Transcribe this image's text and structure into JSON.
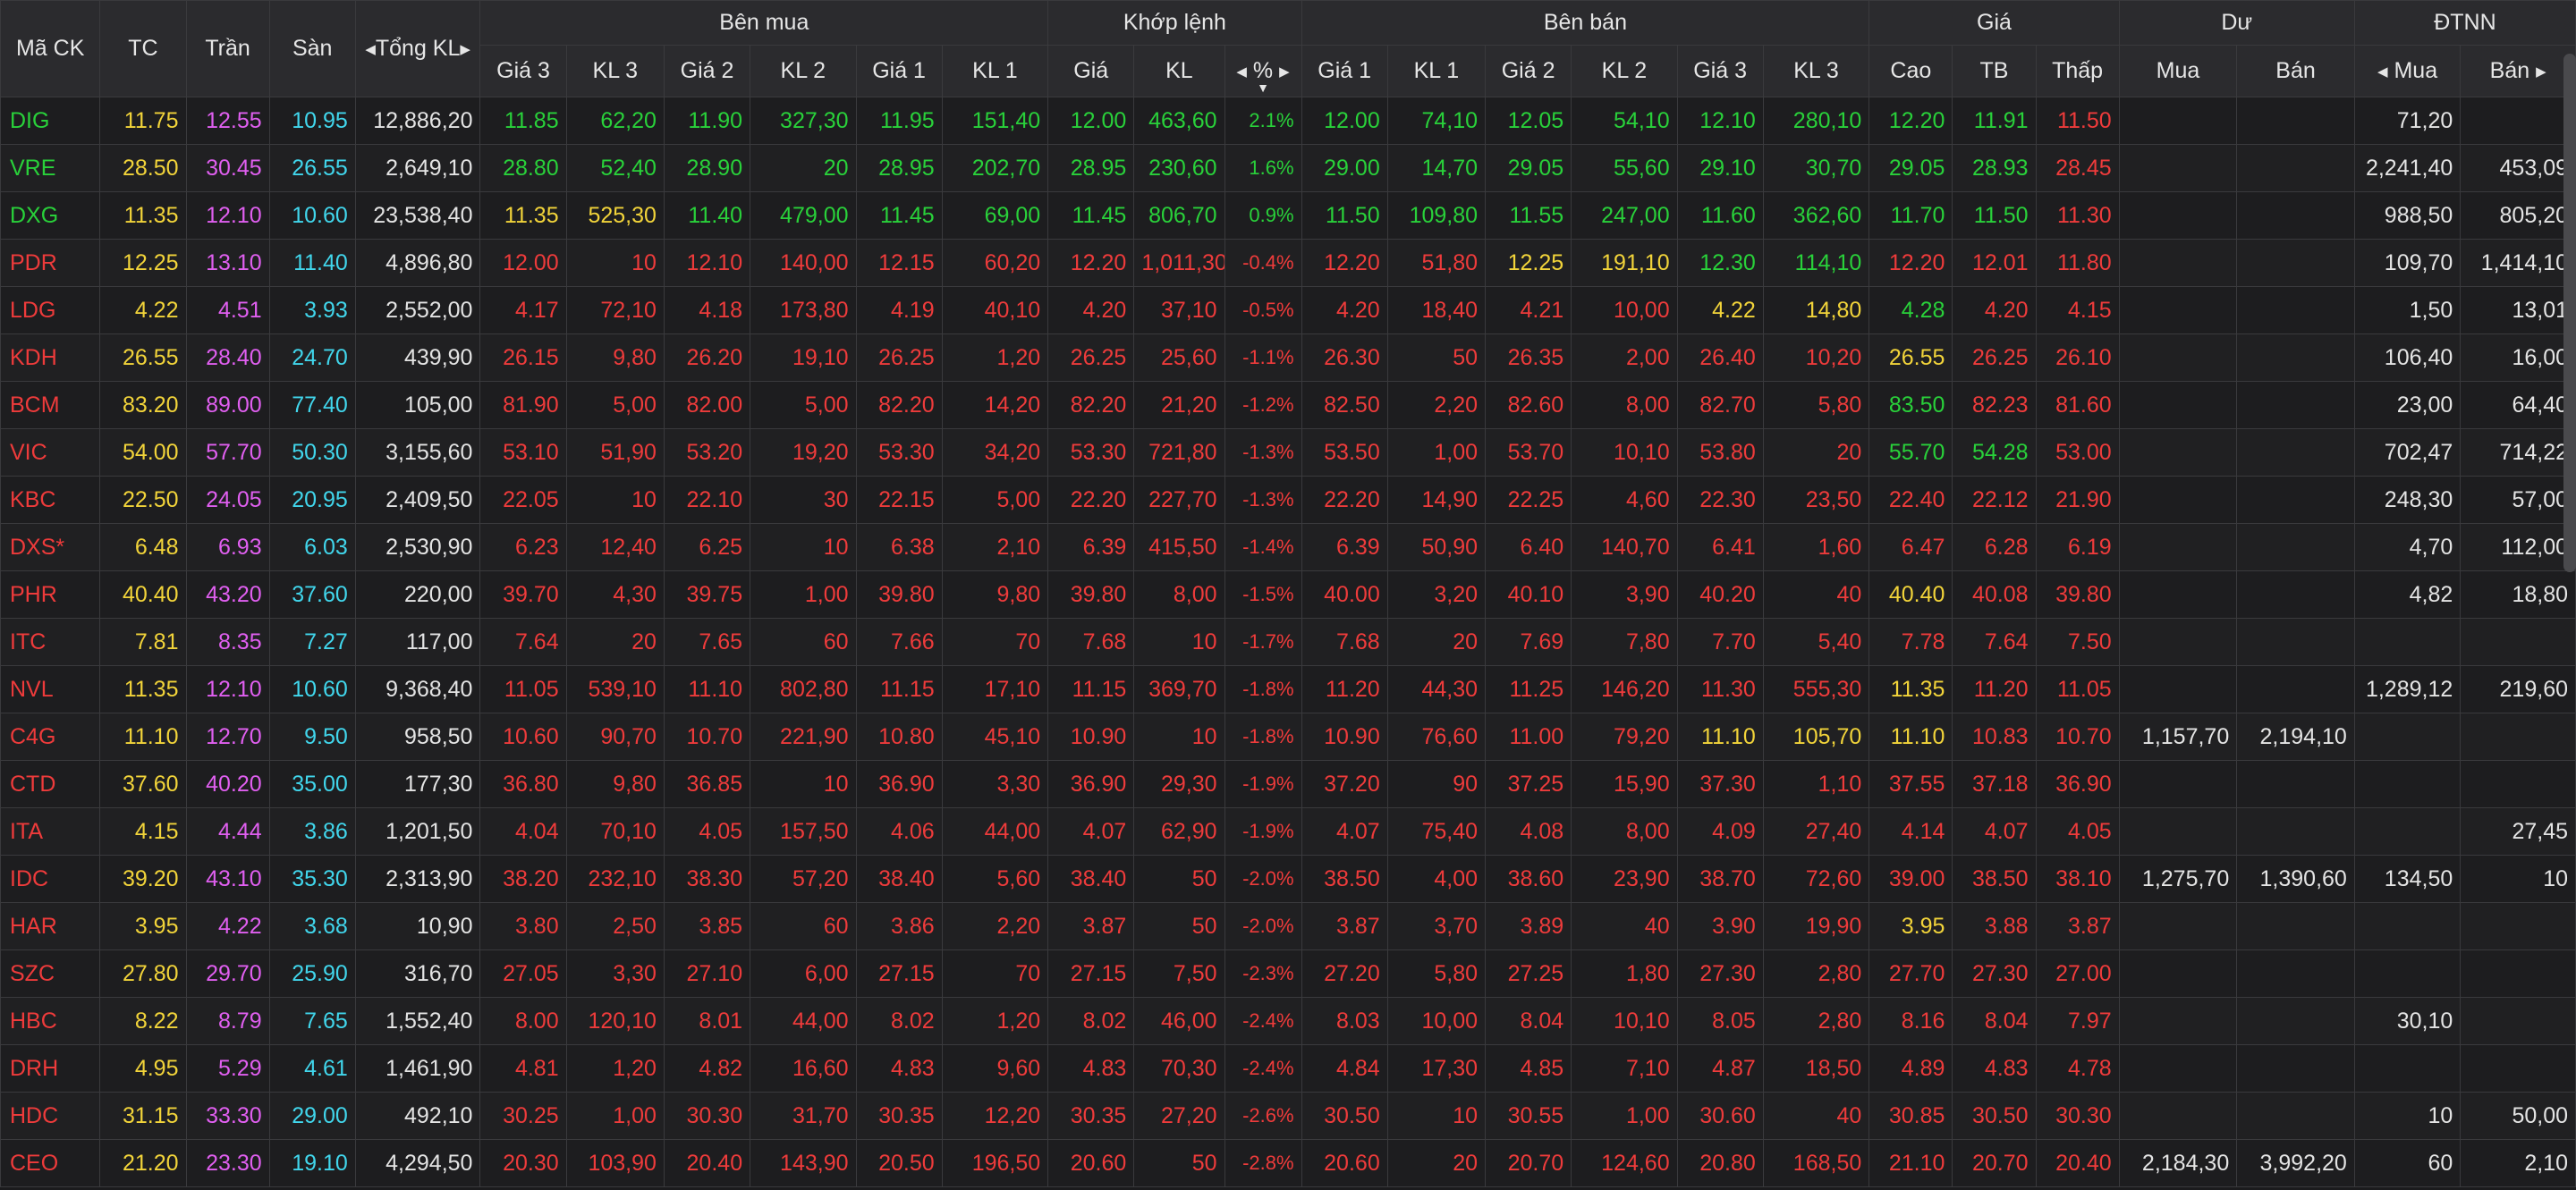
{
  "header": {
    "symbol": "Mã CK",
    "ref": "TC",
    "ceiling": "Trần",
    "floor": "Sàn",
    "total_volume": "Tổng KL",
    "buy_group": "Bên mua",
    "match_group": "Khớp lệnh",
    "sell_group": "Bên bán",
    "price_group": "Giá",
    "surplus_group": "Dư",
    "foreign_group": "ĐTNN",
    "bid3_price": "Giá 3",
    "bid3_vol": "KL 3",
    "bid2_price": "Giá 2",
    "bid2_vol": "KL 2",
    "bid1_price": "Giá 1",
    "bid1_vol": "KL 1",
    "match_price": "Giá",
    "match_vol": "KL",
    "match_pct": "%",
    "ask1_price": "Giá 1",
    "ask1_vol": "KL 1",
    "ask2_price": "Giá 2",
    "ask2_vol": "KL 2",
    "ask3_price": "Giá 3",
    "ask3_vol": "KL 3",
    "high": "Cao",
    "avg": "TB",
    "low": "Thấp",
    "surplus_buy": "Mua",
    "surplus_sell": "Bán",
    "foreign_buy": "Mua",
    "foreign_sell": "Bán"
  },
  "icons": {
    "left_arrow": "caret-left-icon",
    "right_arrow": "caret-right-icon",
    "sort_down": "sort-down-icon"
  },
  "colors": {
    "up": "#29d13a",
    "down": "#ee3b3b",
    "reference": "#f2d43a",
    "ceiling": "#e05ff0",
    "floor": "#41d6ec",
    "background": "#1b1b1d",
    "header_bg": "#2b2b2e"
  },
  "rows": [
    {
      "sym": "DIG",
      "tc": "11.75",
      "tran": "12.55",
      "san": "10.95",
      "tong": "12,886,20",
      "g3": "11.85",
      "k3": "62,20",
      "g2": "11.90",
      "k2": "327,30",
      "g1": "11.95",
      "k1": "151,40",
      "mp": "12.00",
      "mv": "463,60",
      "pct": "2.1%",
      "ag1": "12.00",
      "av1": "74,10",
      "ag2": "12.05",
      "av2": "54,10",
      "ag3": "12.10",
      "av3": "280,10",
      "cao": "12.20",
      "tb": "11.91",
      "thap": "11.50",
      "dm": "",
      "db": "",
      "fm": "71,20",
      "fb": ""
    },
    {
      "sym": "VRE",
      "tc": "28.50",
      "tran": "30.45",
      "san": "26.55",
      "tong": "2,649,10",
      "g3": "28.80",
      "k3": "52,40",
      "g2": "28.90",
      "k2": "20",
      "g1": "28.95",
      "k1": "202,70",
      "mp": "28.95",
      "mv": "230,60",
      "pct": "1.6%",
      "ag1": "29.00",
      "av1": "14,70",
      "ag2": "29.05",
      "av2": "55,60",
      "ag3": "29.10",
      "av3": "30,70",
      "cao": "29.05",
      "tb": "28.93",
      "thap": "28.45",
      "dm": "",
      "db": "",
      "fm": "2,241,40",
      "fb": "453,09"
    },
    {
      "sym": "DXG",
      "tc": "11.35",
      "tran": "12.10",
      "san": "10.60",
      "tong": "23,538,40",
      "g3": "11.35",
      "k3": "525,30",
      "g2": "11.40",
      "k2": "479,00",
      "g1": "11.45",
      "k1": "69,00",
      "mp": "11.45",
      "mv": "806,70",
      "pct": "0.9%",
      "ag1": "11.50",
      "av1": "109,80",
      "ag2": "11.55",
      "av2": "247,00",
      "ag3": "11.60",
      "av3": "362,60",
      "cao": "11.70",
      "tb": "11.50",
      "thap": "11.30",
      "dm": "",
      "db": "",
      "fm": "988,50",
      "fb": "805,20"
    },
    {
      "sym": "PDR",
      "tc": "12.25",
      "tran": "13.10",
      "san": "11.40",
      "tong": "4,896,80",
      "g3": "12.00",
      "k3": "10",
      "g2": "12.10",
      "k2": "140,00",
      "g1": "12.15",
      "k1": "60,20",
      "mp": "12.20",
      "mv": "1,011,30",
      "pct": "-0.4%",
      "ag1": "12.20",
      "av1": "51,80",
      "ag2": "12.25",
      "av2": "191,10",
      "ag3": "12.30",
      "av3": "114,10",
      "cao": "12.20",
      "tb": "12.01",
      "thap": "11.80",
      "dm": "",
      "db": "",
      "fm": "109,70",
      "fb": "1,414,10"
    },
    {
      "sym": "LDG",
      "tc": "4.22",
      "tran": "4.51",
      "san": "3.93",
      "tong": "2,552,00",
      "g3": "4.17",
      "k3": "72,10",
      "g2": "4.18",
      "k2": "173,80",
      "g1": "4.19",
      "k1": "40,10",
      "mp": "4.20",
      "mv": "37,10",
      "pct": "-0.5%",
      "ag1": "4.20",
      "av1": "18,40",
      "ag2": "4.21",
      "av2": "10,00",
      "ag3": "4.22",
      "av3": "14,80",
      "cao": "4.28",
      "tb": "4.20",
      "thap": "4.15",
      "dm": "",
      "db": "",
      "fm": "1,50",
      "fb": "13,01"
    },
    {
      "sym": "KDH",
      "tc": "26.55",
      "tran": "28.40",
      "san": "24.70",
      "tong": "439,90",
      "g3": "26.15",
      "k3": "9,80",
      "g2": "26.20",
      "k2": "19,10",
      "g1": "26.25",
      "k1": "1,20",
      "mp": "26.25",
      "mv": "25,60",
      "pct": "-1.1%",
      "ag1": "26.30",
      "av1": "50",
      "ag2": "26.35",
      "av2": "2,00",
      "ag3": "26.40",
      "av3": "10,20",
      "cao": "26.55",
      "tb": "26.25",
      "thap": "26.10",
      "dm": "",
      "db": "",
      "fm": "106,40",
      "fb": "16,00"
    },
    {
      "sym": "BCM",
      "tc": "83.20",
      "tran": "89.00",
      "san": "77.40",
      "tong": "105,00",
      "g3": "81.90",
      "k3": "5,00",
      "g2": "82.00",
      "k2": "5,00",
      "g1": "82.20",
      "k1": "14,20",
      "mp": "82.20",
      "mv": "21,20",
      "pct": "-1.2%",
      "ag1": "82.50",
      "av1": "2,20",
      "ag2": "82.60",
      "av2": "8,00",
      "ag3": "82.70",
      "av3": "5,80",
      "cao": "83.50",
      "tb": "82.23",
      "thap": "81.60",
      "dm": "",
      "db": "",
      "fm": "23,00",
      "fb": "64,40"
    },
    {
      "sym": "VIC",
      "tc": "54.00",
      "tran": "57.70",
      "san": "50.30",
      "tong": "3,155,60",
      "g3": "53.10",
      "k3": "51,90",
      "g2": "53.20",
      "k2": "19,20",
      "g1": "53.30",
      "k1": "34,20",
      "mp": "53.30",
      "mv": "721,80",
      "pct": "-1.3%",
      "ag1": "53.50",
      "av1": "1,00",
      "ag2": "53.70",
      "av2": "10,10",
      "ag3": "53.80",
      "av3": "20",
      "cao": "55.70",
      "tb": "54.28",
      "thap": "53.00",
      "dm": "",
      "db": "",
      "fm": "702,47",
      "fb": "714,22"
    },
    {
      "sym": "KBC",
      "tc": "22.50",
      "tran": "24.05",
      "san": "20.95",
      "tong": "2,409,50",
      "g3": "22.05",
      "k3": "10",
      "g2": "22.10",
      "k2": "30",
      "g1": "22.15",
      "k1": "5,00",
      "mp": "22.20",
      "mv": "227,70",
      "pct": "-1.3%",
      "ag1": "22.20",
      "av1": "14,90",
      "ag2": "22.25",
      "av2": "4,60",
      "ag3": "22.30",
      "av3": "23,50",
      "cao": "22.40",
      "tb": "22.12",
      "thap": "21.90",
      "dm": "",
      "db": "",
      "fm": "248,30",
      "fb": "57,00"
    },
    {
      "sym": "DXS*",
      "tc": "6.48",
      "tran": "6.93",
      "san": "6.03",
      "tong": "2,530,90",
      "g3": "6.23",
      "k3": "12,40",
      "g2": "6.25",
      "k2": "10",
      "g1": "6.38",
      "k1": "2,10",
      "mp": "6.39",
      "mv": "415,50",
      "pct": "-1.4%",
      "ag1": "6.39",
      "av1": "50,90",
      "ag2": "6.40",
      "av2": "140,70",
      "ag3": "6.41",
      "av3": "1,60",
      "cao": "6.47",
      "tb": "6.28",
      "thap": "6.19",
      "dm": "",
      "db": "",
      "fm": "4,70",
      "fb": "112,00"
    },
    {
      "sym": "PHR",
      "tc": "40.40",
      "tran": "43.20",
      "san": "37.60",
      "tong": "220,00",
      "g3": "39.70",
      "k3": "4,30",
      "g2": "39.75",
      "k2": "1,00",
      "g1": "39.80",
      "k1": "9,80",
      "mp": "39.80",
      "mv": "8,00",
      "pct": "-1.5%",
      "ag1": "40.00",
      "av1": "3,20",
      "ag2": "40.10",
      "av2": "3,90",
      "ag3": "40.20",
      "av3": "40",
      "cao": "40.40",
      "tb": "40.08",
      "thap": "39.80",
      "dm": "",
      "db": "",
      "fm": "4,82",
      "fb": "18,80"
    },
    {
      "sym": "ITC",
      "tc": "7.81",
      "tran": "8.35",
      "san": "7.27",
      "tong": "117,00",
      "g3": "7.64",
      "k3": "20",
      "g2": "7.65",
      "k2": "60",
      "g1": "7.66",
      "k1": "70",
      "mp": "7.68",
      "mv": "10",
      "pct": "-1.7%",
      "ag1": "7.68",
      "av1": "20",
      "ag2": "7.69",
      "av2": "7,80",
      "ag3": "7.70",
      "av3": "5,40",
      "cao": "7.78",
      "tb": "7.64",
      "thap": "7.50",
      "dm": "",
      "db": "",
      "fm": "",
      "fb": ""
    },
    {
      "sym": "NVL",
      "tc": "11.35",
      "tran": "12.10",
      "san": "10.60",
      "tong": "9,368,40",
      "g3": "11.05",
      "k3": "539,10",
      "g2": "11.10",
      "k2": "802,80",
      "g1": "11.15",
      "k1": "17,10",
      "mp": "11.15",
      "mv": "369,70",
      "pct": "-1.8%",
      "ag1": "11.20",
      "av1": "44,30",
      "ag2": "11.25",
      "av2": "146,20",
      "ag3": "11.30",
      "av3": "555,30",
      "cao": "11.35",
      "tb": "11.20",
      "thap": "11.05",
      "dm": "",
      "db": "",
      "fm": "1,289,12",
      "fb": "219,60"
    },
    {
      "sym": "C4G",
      "tc": "11.10",
      "tran": "12.70",
      "san": "9.50",
      "tong": "958,50",
      "g3": "10.60",
      "k3": "90,70",
      "g2": "10.70",
      "k2": "221,90",
      "g1": "10.80",
      "k1": "45,10",
      "mp": "10.90",
      "mv": "10",
      "pct": "-1.8%",
      "ag1": "10.90",
      "av1": "76,60",
      "ag2": "11.00",
      "av2": "79,20",
      "ag3": "11.10",
      "av3": "105,70",
      "cao": "11.10",
      "tb": "10.83",
      "thap": "10.70",
      "dm": "1,157,70",
      "db": "2,194,10",
      "fm": "",
      "fb": ""
    },
    {
      "sym": "CTD",
      "tc": "37.60",
      "tran": "40.20",
      "san": "35.00",
      "tong": "177,30",
      "g3": "36.80",
      "k3": "9,80",
      "g2": "36.85",
      "k2": "10",
      "g1": "36.90",
      "k1": "3,30",
      "mp": "36.90",
      "mv": "29,30",
      "pct": "-1.9%",
      "ag1": "37.20",
      "av1": "90",
      "ag2": "37.25",
      "av2": "15,90",
      "ag3": "37.30",
      "av3": "1,10",
      "cao": "37.55",
      "tb": "37.18",
      "thap": "36.90",
      "dm": "",
      "db": "",
      "fm": "",
      "fb": ""
    },
    {
      "sym": "ITA",
      "tc": "4.15",
      "tran": "4.44",
      "san": "3.86",
      "tong": "1,201,50",
      "g3": "4.04",
      "k3": "70,10",
      "g2": "4.05",
      "k2": "157,50",
      "g1": "4.06",
      "k1": "44,00",
      "mp": "4.07",
      "mv": "62,90",
      "pct": "-1.9%",
      "ag1": "4.07",
      "av1": "75,40",
      "ag2": "4.08",
      "av2": "8,00",
      "ag3": "4.09",
      "av3": "27,40",
      "cao": "4.14",
      "tb": "4.07",
      "thap": "4.05",
      "dm": "",
      "db": "",
      "fm": "",
      "fb": "27,45"
    },
    {
      "sym": "IDC",
      "tc": "39.20",
      "tran": "43.10",
      "san": "35.30",
      "tong": "2,313,90",
      "g3": "38.20",
      "k3": "232,10",
      "g2": "38.30",
      "k2": "57,20",
      "g1": "38.40",
      "k1": "5,60",
      "mp": "38.40",
      "mv": "50",
      "pct": "-2.0%",
      "ag1": "38.50",
      "av1": "4,00",
      "ag2": "38.60",
      "av2": "23,90",
      "ag3": "38.70",
      "av3": "72,60",
      "cao": "39.00",
      "tb": "38.50",
      "thap": "38.10",
      "dm": "1,275,70",
      "db": "1,390,60",
      "fm": "134,50",
      "fb": "10"
    },
    {
      "sym": "HAR",
      "tc": "3.95",
      "tran": "4.22",
      "san": "3.68",
      "tong": "10,90",
      "g3": "3.80",
      "k3": "2,50",
      "g2": "3.85",
      "k2": "60",
      "g1": "3.86",
      "k1": "2,20",
      "mp": "3.87",
      "mv": "50",
      "pct": "-2.0%",
      "ag1": "3.87",
      "av1": "3,70",
      "ag2": "3.89",
      "av2": "40",
      "ag3": "3.90",
      "av3": "19,90",
      "cao": "3.95",
      "tb": "3.88",
      "thap": "3.87",
      "dm": "",
      "db": "",
      "fm": "",
      "fb": ""
    },
    {
      "sym": "SZC",
      "tc": "27.80",
      "tran": "29.70",
      "san": "25.90",
      "tong": "316,70",
      "g3": "27.05",
      "k3": "3,30",
      "g2": "27.10",
      "k2": "6,00",
      "g1": "27.15",
      "k1": "70",
      "mp": "27.15",
      "mv": "7,50",
      "pct": "-2.3%",
      "ag1": "27.20",
      "av1": "5,80",
      "ag2": "27.25",
      "av2": "1,80",
      "ag3": "27.30",
      "av3": "2,80",
      "cao": "27.70",
      "tb": "27.30",
      "thap": "27.00",
      "dm": "",
      "db": "",
      "fm": "",
      "fb": ""
    },
    {
      "sym": "HBC",
      "tc": "8.22",
      "tran": "8.79",
      "san": "7.65",
      "tong": "1,552,40",
      "g3": "8.00",
      "k3": "120,10",
      "g2": "8.01",
      "k2": "44,00",
      "g1": "8.02",
      "k1": "1,20",
      "mp": "8.02",
      "mv": "46,00",
      "pct": "-2.4%",
      "ag1": "8.03",
      "av1": "10,00",
      "ag2": "8.04",
      "av2": "10,10",
      "ag3": "8.05",
      "av3": "2,80",
      "cao": "8.16",
      "tb": "8.04",
      "thap": "7.97",
      "dm": "",
      "db": "",
      "fm": "30,10",
      "fb": ""
    },
    {
      "sym": "DRH",
      "tc": "4.95",
      "tran": "5.29",
      "san": "4.61",
      "tong": "1,461,90",
      "g3": "4.81",
      "k3": "1,20",
      "g2": "4.82",
      "k2": "16,60",
      "g1": "4.83",
      "k1": "9,60",
      "mp": "4.83",
      "mv": "70,30",
      "pct": "-2.4%",
      "ag1": "4.84",
      "av1": "17,30",
      "ag2": "4.85",
      "av2": "7,10",
      "ag3": "4.87",
      "av3": "18,50",
      "cao": "4.89",
      "tb": "4.83",
      "thap": "4.78",
      "dm": "",
      "db": "",
      "fm": "",
      "fb": ""
    },
    {
      "sym": "HDC",
      "tc": "31.15",
      "tran": "33.30",
      "san": "29.00",
      "tong": "492,10",
      "g3": "30.25",
      "k3": "1,00",
      "g2": "30.30",
      "k2": "31,70",
      "g1": "30.35",
      "k1": "12,20",
      "mp": "30.35",
      "mv": "27,20",
      "pct": "-2.6%",
      "ag1": "30.50",
      "av1": "10",
      "ag2": "30.55",
      "av2": "1,00",
      "ag3": "30.60",
      "av3": "40",
      "cao": "30.85",
      "tb": "30.50",
      "thap": "30.30",
      "dm": "",
      "db": "",
      "fm": "10",
      "fb": "50,00"
    },
    {
      "sym": "CEO",
      "tc": "21.20",
      "tran": "23.30",
      "san": "19.10",
      "tong": "4,294,50",
      "g3": "20.30",
      "k3": "103,90",
      "g2": "20.40",
      "k2": "143,90",
      "g1": "20.50",
      "k1": "196,50",
      "mp": "20.60",
      "mv": "50",
      "pct": "-2.8%",
      "ag1": "20.60",
      "av1": "20",
      "ag2": "20.70",
      "av2": "124,60",
      "ag3": "20.80",
      "av3": "168,50",
      "cao": "21.10",
      "tb": "20.70",
      "thap": "20.40",
      "dm": "2,184,30",
      "db": "3,992,20",
      "fm": "60",
      "fb": "2,10"
    }
  ]
}
